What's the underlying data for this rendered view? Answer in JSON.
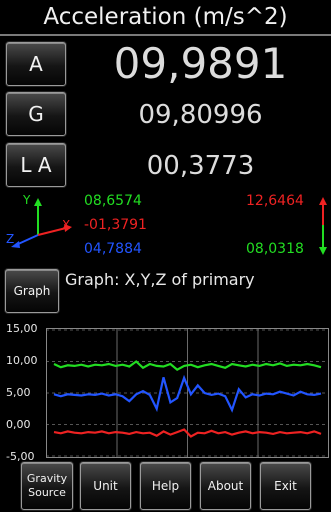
{
  "title": "Acceleration (m/s^2)",
  "modes": [
    {
      "label": "A",
      "value": "09,9891"
    },
    {
      "label": "G",
      "value": "09,80996"
    },
    {
      "label": "L A",
      "value": "00,3773"
    }
  ],
  "axes": {
    "x_label": "X",
    "y_label": "Y",
    "z_label": "Z",
    "x_value": "-01,3791",
    "y_value": "08,6574",
    "z_value": "04,7884",
    "max_value": "12,6464",
    "min_value": "08,0318"
  },
  "graph": {
    "button_label": "Graph",
    "caption": "Graph: X,Y,Z of primary"
  },
  "chart_data": {
    "type": "line",
    "yticks": [
      "15,00",
      "10,00",
      "5,00",
      "0,00",
      "-5,00"
    ],
    "ylim": [
      -5,
      15
    ],
    "x": [
      0,
      1,
      2,
      3,
      4,
      5,
      6,
      7,
      8,
      9,
      10,
      11,
      12,
      13,
      14,
      15,
      16,
      17,
      18,
      19,
      20,
      21,
      22,
      23,
      24,
      25,
      26,
      27,
      28,
      29,
      30,
      31,
      32,
      33,
      34,
      35,
      36,
      37,
      38,
      39
    ],
    "series": [
      {
        "color": "#22dd22",
        "values": [
          9.6,
          9.1,
          9.4,
          9.3,
          9.5,
          9.2,
          9.5,
          9.4,
          9.6,
          9.3,
          9.5,
          9.2,
          10.0,
          9.0,
          9.6,
          9.3,
          9.2,
          9.6,
          8.7,
          9.3,
          9.5,
          9.1,
          9.4,
          9.6,
          9.3,
          9.0,
          9.6,
          9.4,
          9.2,
          9.5,
          9.3,
          9.6,
          9.4,
          9.7,
          9.3,
          9.5,
          9.4,
          9.6,
          9.4,
          9.1
        ]
      },
      {
        "color": "#2255ff",
        "values": [
          4.8,
          4.5,
          4.8,
          4.7,
          4.6,
          4.8,
          4.7,
          4.9,
          4.6,
          4.8,
          4.5,
          3.7,
          4.8,
          5.3,
          4.7,
          2.5,
          7.5,
          3.5,
          4.2,
          7.4,
          4.8,
          6.2,
          5.0,
          4.7,
          4.9,
          4.5,
          2.3,
          5.6,
          4.3,
          4.8,
          4.6,
          4.9,
          4.8,
          5.2,
          4.9,
          4.6,
          5.2,
          4.8,
          4.7,
          4.9
        ]
      },
      {
        "color": "#ee2222",
        "values": [
          -1.2,
          -1.4,
          -1.1,
          -1.3,
          -1.4,
          -1.2,
          -1.3,
          -1.1,
          -1.4,
          -1.2,
          -1.3,
          -1.5,
          -1.2,
          -1.4,
          -1.3,
          -1.8,
          -1.1,
          -1.6,
          -1.2,
          -0.8,
          -1.9,
          -1.3,
          -1.4,
          -1.0,
          -1.4,
          -1.2,
          -1.6,
          -1.3,
          -1.1,
          -1.4,
          -1.2,
          -1.3,
          -1.5,
          -1.2,
          -1.4,
          -1.3,
          -1.2,
          -1.4,
          -1.1,
          -1.5
        ]
      }
    ]
  },
  "bottom_buttons": [
    "Gravity Source",
    "Unit",
    "Help",
    "About",
    "Exit"
  ]
}
